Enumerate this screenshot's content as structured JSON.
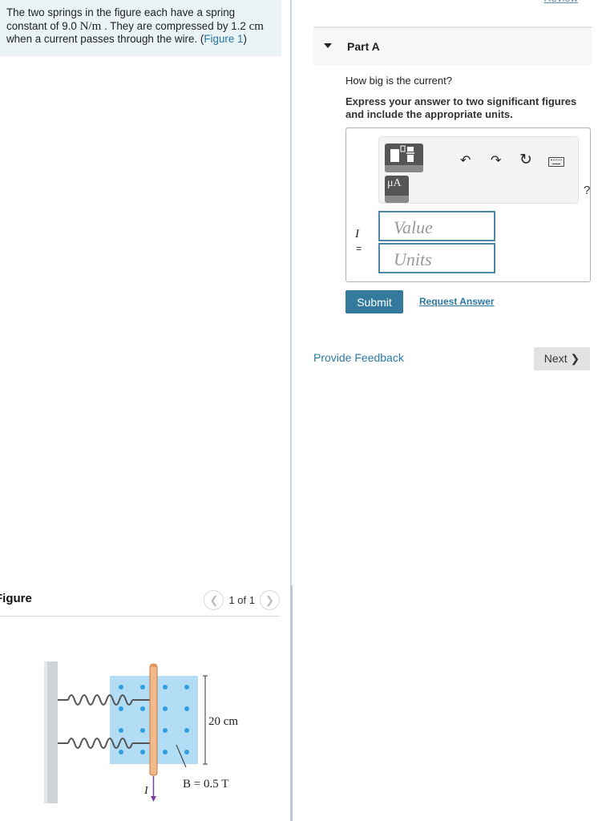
{
  "problem": {
    "text_1": "The two springs in the figure each have a spring constant of 9.0 ",
    "spring_constant_unit": "N/m",
    "text_2": " . They are compressed by 1.2 ",
    "compression_unit": "cm",
    "text_3": " when a current passes through the wire. (",
    "figure_link": "Figure 1",
    "text_4": ")"
  },
  "header": {
    "review_link": "Review"
  },
  "part": {
    "title": "Part A",
    "question": "How big is the current?",
    "instruction": "Express your answer to two significant figures and include the appropriate units."
  },
  "answer": {
    "toolbar": {
      "templates_icon": "templates-icon",
      "units_label": "μA",
      "undo_icon": "undo-icon",
      "redo_icon": "redo-icon",
      "reset_icon": "reset-icon",
      "keyboard_icon": "keyboard-icon",
      "help_label": "?"
    },
    "variable": "I",
    "equals": "=",
    "value_placeholder": "Value",
    "units_placeholder": "Units",
    "value": "",
    "units": ""
  },
  "actions": {
    "submit": "Submit",
    "request_answer": "Request Answer",
    "provide_feedback": "Provide Feedback",
    "next": "Next ❯"
  },
  "figure": {
    "title": "Figure",
    "pager": "1 of 1",
    "prev_icon": "chevron-left-icon",
    "next_icon": "chevron-right-icon",
    "labels": {
      "length": "20 cm",
      "field": "B = 0.5 T",
      "current": "I"
    },
    "colors": {
      "field_region": "#b3dcf5",
      "field_dots": "#2e9ee0",
      "wire": "#f2b98a",
      "wall": "#cfd4d6",
      "current_arrow": "#7b3fa0"
    }
  },
  "colors": {
    "accent": "#337a9c",
    "link": "#2b78a8",
    "intro_bg": "#eaf4f7"
  }
}
